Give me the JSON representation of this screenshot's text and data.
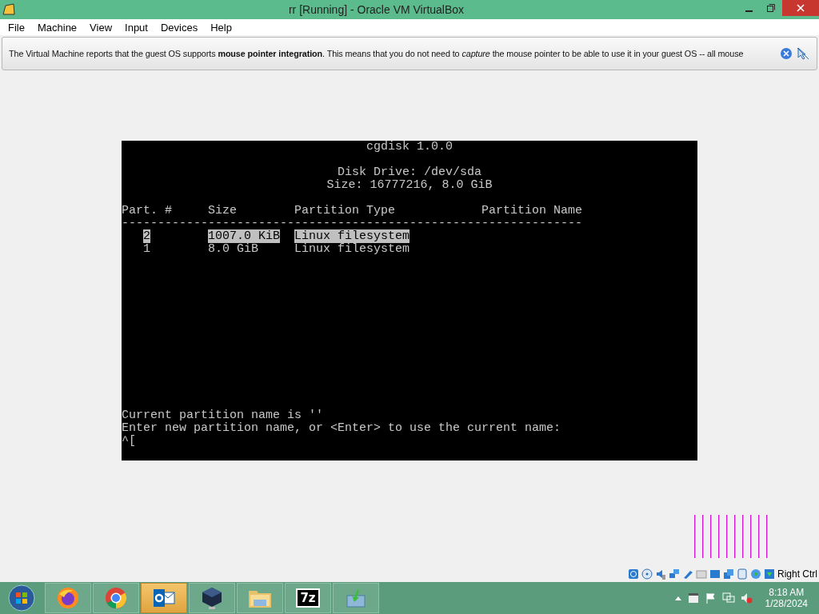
{
  "window": {
    "title": "rr [Running] - Oracle VM VirtualBox"
  },
  "menu": [
    "File",
    "Machine",
    "View",
    "Input",
    "Devices",
    "Help"
  ],
  "notice": {
    "text": "The Virtual Machine reports that the guest OS supports **mouse pointer integration**. This means that you do not need to *capture* the mouse pointer to be able to use it in your guest OS -- all mouse"
  },
  "terminal": {
    "title": "cgdisk 1.0.0",
    "disk_lines": [
      "Disk Drive: /dev/sda",
      "Size: 16777216, 8.0 GiB"
    ],
    "columns": [
      "Part. #",
      "Size",
      "Partition Type",
      "Partition Name"
    ],
    "separator": "----------------------------------------------------------------",
    "rows": [
      {
        "part": "2",
        "size": "1007.0 KiB",
        "type": "Linux filesystem",
        "selected": true
      },
      {
        "part": "1",
        "size": "8.0 GiB",
        "type": "Linux filesystem",
        "selected": false
      }
    ],
    "prompt_lines": [
      "Current partition name is ''",
      "Enter new partition name, or <Enter> to use the current name:",
      "^["
    ]
  },
  "status_bar": {
    "host_key": "Right Ctrl"
  },
  "taskbar": {
    "apps": [
      {
        "kind": "firefox",
        "active": false
      },
      {
        "kind": "chrome",
        "active": false
      },
      {
        "kind": "outlook",
        "active": true
      },
      {
        "kind": "virtualbox",
        "active": false
      },
      {
        "kind": "explorer",
        "active": false
      },
      {
        "kind": "sevenzip",
        "label": "7z",
        "active": false
      },
      {
        "kind": "installer",
        "active": false
      }
    ],
    "time": "8:18 AM",
    "date": "1/28/2024"
  }
}
